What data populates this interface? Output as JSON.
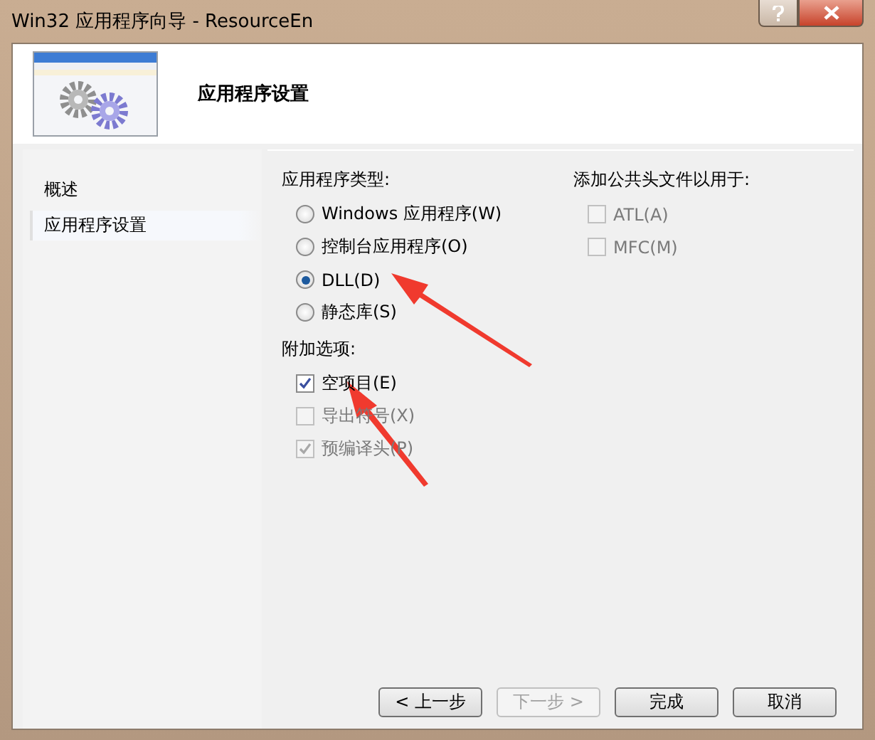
{
  "window": {
    "title": "Win32 应用程序向导 - ResourceEn"
  },
  "header": {
    "title": "应用程序设置"
  },
  "sidebar": {
    "items": [
      {
        "label": "概述",
        "selected": false
      },
      {
        "label": "应用程序设置",
        "selected": true
      }
    ]
  },
  "app_type": {
    "label": "应用程序类型:",
    "options": [
      {
        "label": "Windows 应用程序(W)",
        "selected": false
      },
      {
        "label": "控制台应用程序(O)",
        "selected": false
      },
      {
        "label": "DLL(D)",
        "selected": true
      },
      {
        "label": "静态库(S)",
        "selected": false
      }
    ]
  },
  "extra_options": {
    "label": "附加选项:",
    "items": [
      {
        "label": "空项目(E)",
        "checked": true,
        "disabled": false
      },
      {
        "label": "导出符号(X)",
        "checked": false,
        "disabled": true
      },
      {
        "label": "预编译头(P)",
        "checked": true,
        "disabled": true
      }
    ]
  },
  "common_headers": {
    "label": "添加公共头文件以用于:",
    "items": [
      {
        "label": "ATL(A)",
        "checked": false,
        "disabled": true
      },
      {
        "label": "MFC(M)",
        "checked": false,
        "disabled": true
      }
    ]
  },
  "buttons": [
    {
      "label": "< 上一步",
      "disabled": false
    },
    {
      "label": "下一步 >",
      "disabled": true
    },
    {
      "label": "完成",
      "disabled": false
    },
    {
      "label": "取消",
      "disabled": false
    }
  ]
}
